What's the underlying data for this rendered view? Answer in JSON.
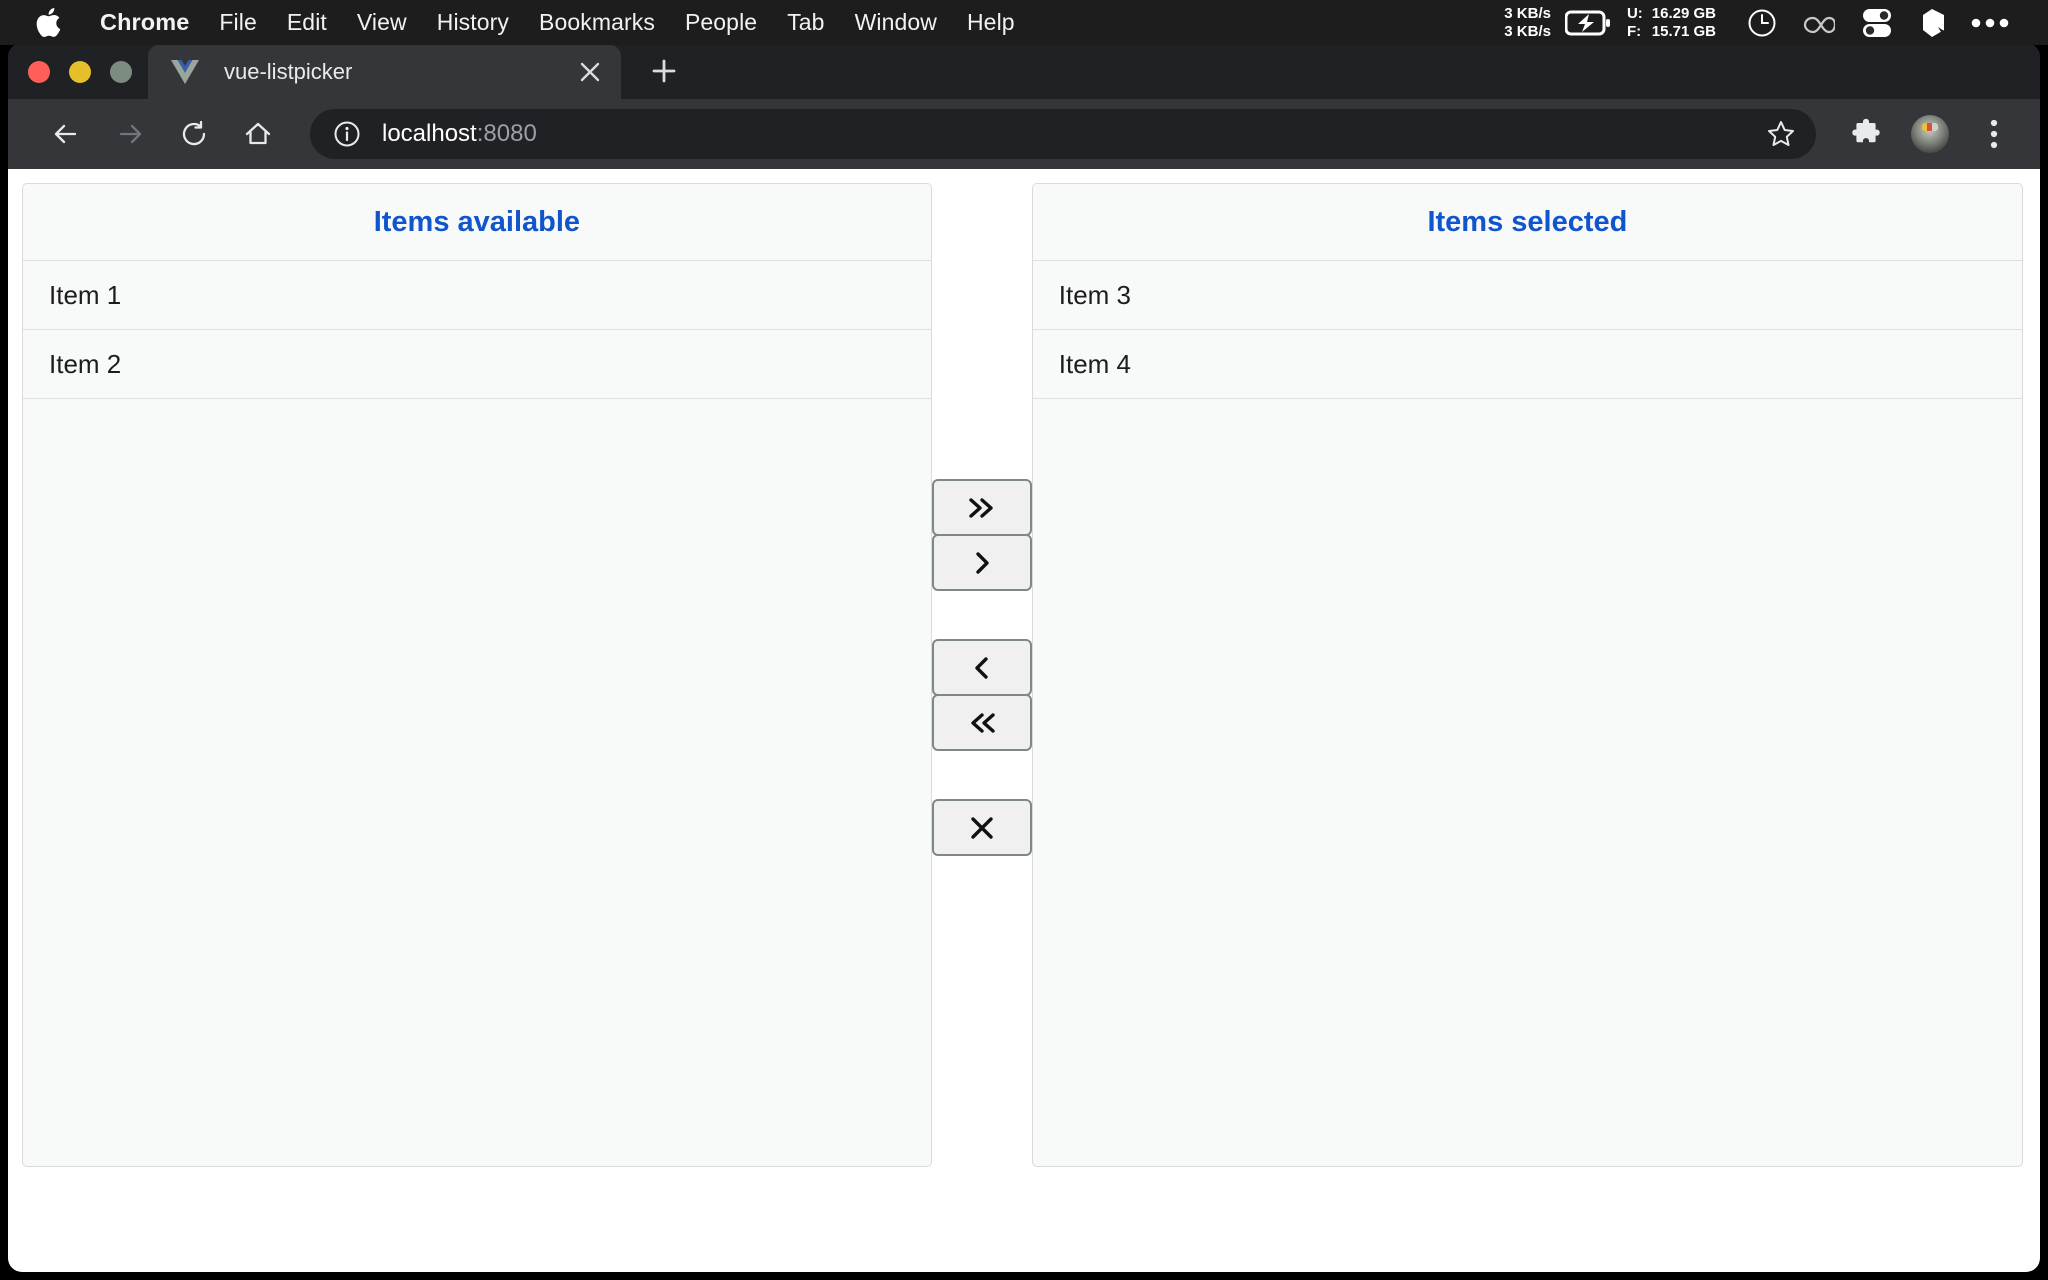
{
  "menubar": {
    "apple_icon": "apple-logo-icon",
    "items": [
      {
        "label": "Chrome",
        "bold": true
      },
      {
        "label": "File"
      },
      {
        "label": "Edit"
      },
      {
        "label": "View"
      },
      {
        "label": "History"
      },
      {
        "label": "Bookmarks"
      },
      {
        "label": "People"
      },
      {
        "label": "Tab"
      },
      {
        "label": "Window"
      },
      {
        "label": "Help"
      }
    ],
    "status": {
      "net_up": "3 KB/s",
      "net_down": "3 KB/s",
      "battery_icon": "battery-charging-icon",
      "disk_used_label": "U:",
      "disk_used_value": "16.29 GB",
      "disk_free_label": "F:",
      "disk_free_value": "15.71 GB",
      "clock_icon": "clock-icon",
      "loop_icon": "loop-icon",
      "toggles_icon": "toggles-icon",
      "shard_icon": "shard-icon",
      "overflow_icon": "ellipsis-icon"
    }
  },
  "browser": {
    "traffic_lights": [
      "close",
      "minimize",
      "zoom"
    ],
    "tab": {
      "favicon": "vue-logo-icon",
      "title": "vue-listpicker",
      "close_icon": "close-icon"
    },
    "new_tab_icon": "plus-icon",
    "toolbar": {
      "back_icon": "back-arrow-icon",
      "forward_icon": "forward-arrow-icon",
      "reload_icon": "reload-icon",
      "home_icon": "home-icon",
      "info_icon": "info-circle-icon",
      "url_host": "localhost",
      "url_port": ":8080",
      "bookmark_icon": "star-icon",
      "extensions_icon": "puzzle-piece-icon",
      "profile_icon": "avatar",
      "menu_icon": "three-dot-menu-icon"
    }
  },
  "page": {
    "available": {
      "title": "Items available",
      "items": [
        "Item 1",
        "Item 2"
      ]
    },
    "selected": {
      "title": "Items selected",
      "items": [
        "Item 3",
        "Item 4"
      ]
    },
    "controls": [
      {
        "name": "move-all-right-button",
        "glyph": "»"
      },
      {
        "name": "move-right-button",
        "glyph": "›"
      },
      {
        "name": "move-left-button",
        "glyph": "‹"
      },
      {
        "name": "move-all-left-button",
        "glyph": "«"
      },
      {
        "name": "clear-button",
        "glyph": "✕"
      }
    ],
    "colors": {
      "heading": "#1155cc",
      "panel_bg": "#f8f9f9",
      "panel_border": "#d8dadb",
      "button_border": "#7e8a80"
    }
  }
}
